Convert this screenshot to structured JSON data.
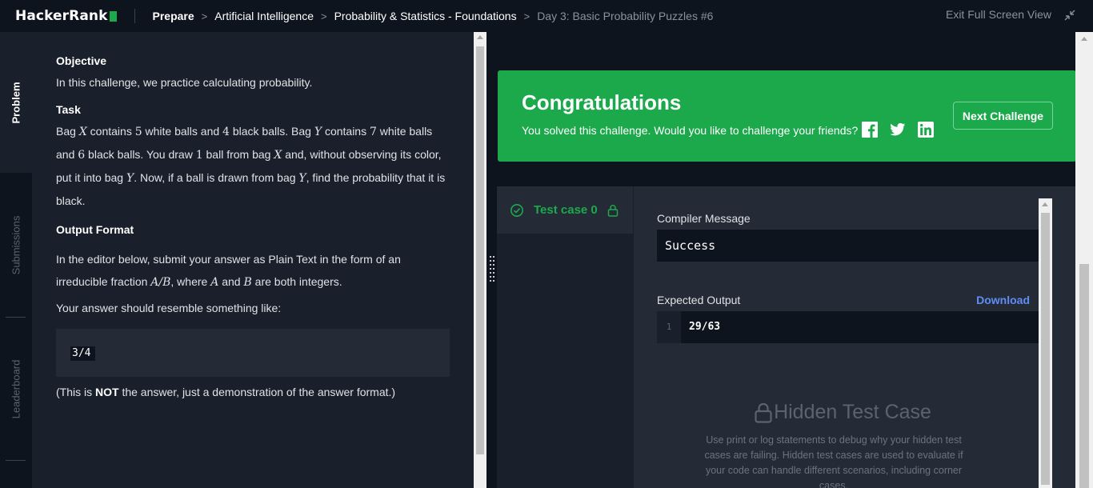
{
  "header": {
    "logo": "HackerRank",
    "breadcrumbs": [
      "Prepare",
      "Artificial Intelligence",
      "Probability & Statistics - Foundations",
      "Day 3: Basic Probability Puzzles #6"
    ],
    "exit_fullscreen": "Exit Full Screen View"
  },
  "rail": {
    "tabs": [
      "Problem",
      "Submissions",
      "Leaderboard"
    ],
    "active": "Problem"
  },
  "problem": {
    "objective_heading": "Objective",
    "objective_text": "In this challenge, we practice calculating probability.",
    "task_heading": "Task",
    "task": {
      "t1": "Bag ",
      "v1": "X",
      "t2": " contains ",
      "n1": "5",
      "t3": " white balls and ",
      "n2": "4",
      "t4": " black balls. Bag ",
      "v2": "Y",
      "t5": " contains ",
      "n3": "7",
      "t6": " white balls and ",
      "n4": "6",
      "t7": " black balls. You draw ",
      "n5": "1",
      "t8": " ball from bag ",
      "v3": "X",
      "t9": " and, without observing its color, put it into bag ",
      "v4": "Y",
      "t10": ". Now, if a ball is drawn from bag ",
      "v5": "Y",
      "t11": ", find the probability that it is black."
    },
    "output_heading": "Output Format",
    "output": {
      "t1": "In the editor below, submit your answer as Plain Text in the form of an irreducible fraction ",
      "m1": "A/B",
      "t2": ", where ",
      "m2": "A",
      "t3": " and ",
      "m3": "B",
      "t4": " are both integers."
    },
    "resemble_text": "Your answer should resemble something like:",
    "example_answer": "3/4",
    "note": {
      "t1": "(This is ",
      "bold": "NOT",
      "t2": " the answer, just a demonstration of the answer format.)"
    }
  },
  "congrats": {
    "title": "Congratulations",
    "message": "You solved this challenge. Would you like to challenge your friends?",
    "social": [
      "facebook-icon",
      "twitter-icon",
      "linkedin-icon"
    ],
    "next_button": "Next Challenge",
    "color": "#1ba94c"
  },
  "results": {
    "test_case_label": "Test case 0",
    "compiler_label": "Compiler Message",
    "compiler_message": "Success",
    "expected_label": "Expected Output",
    "download_label": "Download",
    "expected_line_number": "1",
    "expected_value": "29/63",
    "hidden_title": "Hidden Test Case",
    "hidden_desc": "Use print or log statements to debug why your hidden test cases are failing. Hidden test cases are used to evaluate if your code can handle different scenarios, including corner cases."
  }
}
